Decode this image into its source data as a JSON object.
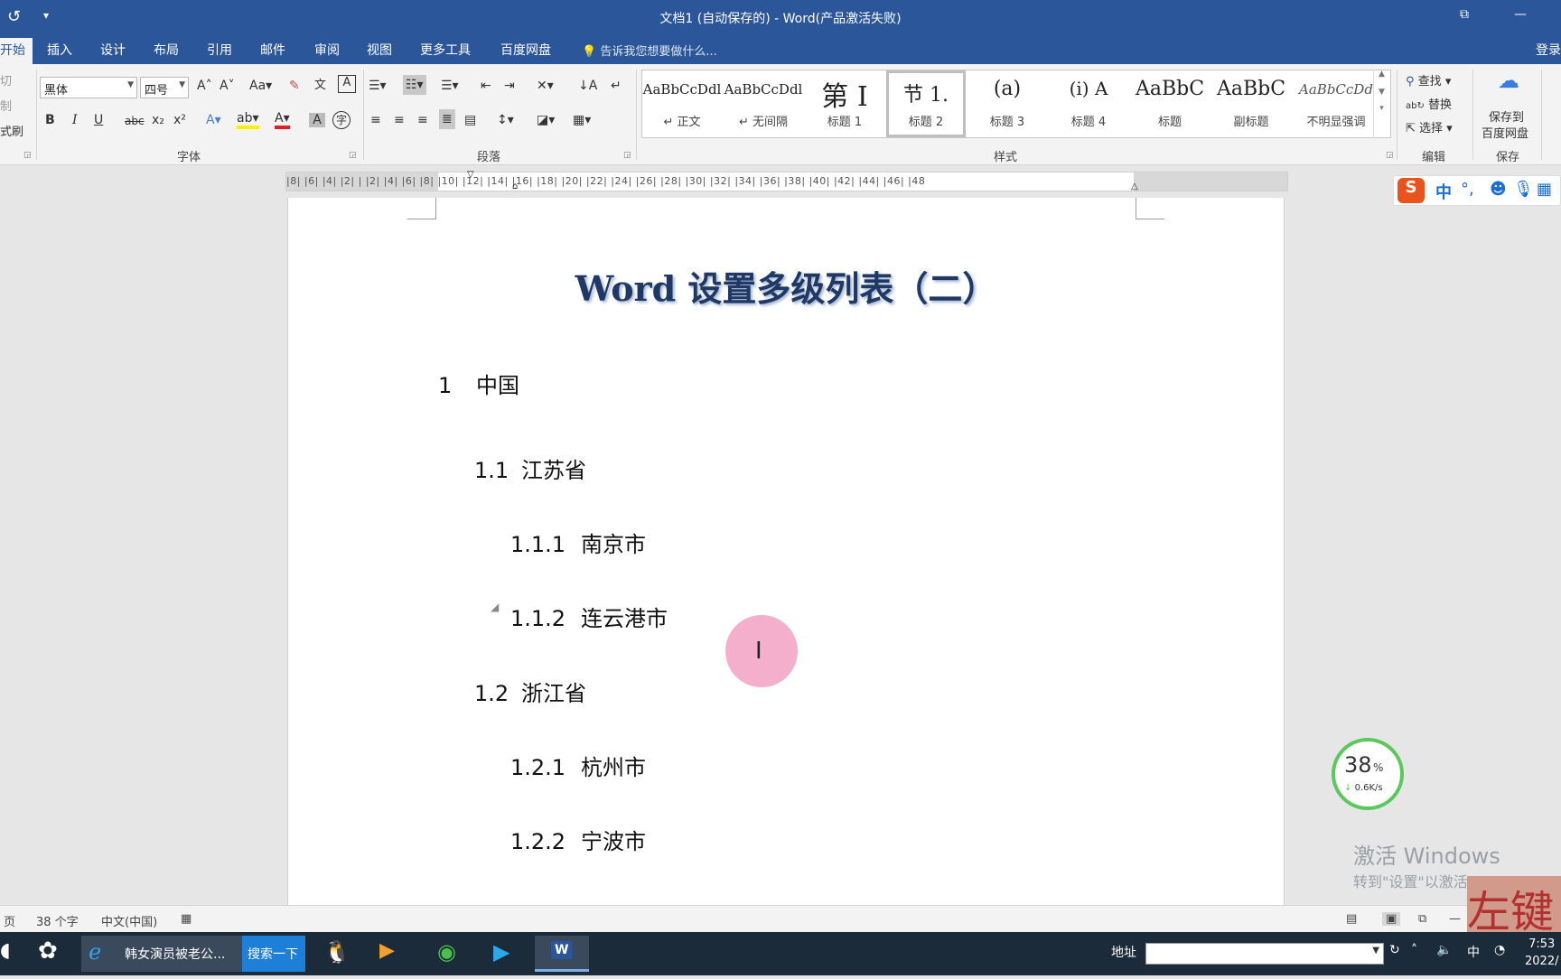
{
  "window": {
    "title": "文档1 (自动保存的) - Word(产品激活失败)",
    "quick_access_icon": "refresh-icon",
    "restore_icon": "restore-icon",
    "minimize": "—"
  },
  "tabs": {
    "items": [
      "开始",
      "插入",
      "设计",
      "布局",
      "引用",
      "邮件",
      "审阅",
      "视图",
      "更多工具",
      "百度网盘"
    ],
    "tell_me": "告诉我您想要做什么...",
    "login": "登录"
  },
  "clipboard": {
    "cut": "切",
    "copy": "制",
    "format_painter": "式刷"
  },
  "font": {
    "family": "黑体",
    "size": "四号",
    "group_label": "字体",
    "bold": "B",
    "italic": "I",
    "underline": "U",
    "strike": "abc",
    "sub": "x₂",
    "sup": "x²",
    "case": "Aa"
  },
  "paragraph": {
    "group_label": "段落"
  },
  "styles": {
    "group_label": "样式",
    "items": [
      {
        "sample": "AaBbCcDdl",
        "name": "↵ 正文"
      },
      {
        "sample": "AaBbCcDdl",
        "name": "↵ 无间隔"
      },
      {
        "sample": "第 I",
        "name": "标题 1"
      },
      {
        "sample": "节 1.",
        "name": "标题 2"
      },
      {
        "sample": "(a)",
        "name": "标题 3"
      },
      {
        "sample": "(i) A",
        "name": "标题 4"
      },
      {
        "sample": "AaBbC",
        "name": "标题"
      },
      {
        "sample": "AaBbC",
        "name": "副标题"
      },
      {
        "sample": "AaBbCcDd",
        "name": "不明显强调"
      }
    ],
    "selected_index": 3
  },
  "editing": {
    "group_label": "编辑",
    "find": "查找",
    "replace": "替换",
    "select": "选择"
  },
  "save": {
    "group_label": "保存",
    "label_line1": "保存到",
    "label_line2": "百度网盘"
  },
  "ruler": {
    "ticks": "|8|  |6|  |4|  |2|  |  |2|  |4|  |6|  |8|  |10|  |12|  |14|  |16|  |18|  |20|  |22|  |24|  |26|  |28|  |30|  |32|  |34|  |36|  |38|  |40|  |42|  |44|  |46|  |48"
  },
  "document": {
    "title": "Word 设置多级列表（二）",
    "items": [
      {
        "num": "1",
        "text": "中国"
      },
      {
        "num": "1.1",
        "text": "江苏省"
      },
      {
        "num": "1.1.1",
        "text": "南京市"
      },
      {
        "num": "1.1.2",
        "text": "连云港市"
      },
      {
        "num": "1.2",
        "text": "浙江省"
      },
      {
        "num": "1.2.1",
        "text": "杭州市"
      },
      {
        "num": "1.2.2",
        "text": "宁波市"
      }
    ]
  },
  "status": {
    "page": "页",
    "words": "38 个字",
    "language": "中文(中国)"
  },
  "ime": {
    "lang": "中",
    "punct": "°,"
  },
  "network": {
    "percent": "38",
    "percent_unit": "%",
    "speed": "0.6K/s"
  },
  "activation": {
    "line1": "激活 Windows",
    "line2": "转到\"设置\"以激活 Windows"
  },
  "decor": {
    "corner_text": "左键"
  },
  "taskbar": {
    "ie_tab": "韩女演员被老公...",
    "search_button": "搜索一下",
    "address_label": "地址",
    "tray_lang": "中",
    "clock_time": "7:53",
    "clock_date": "2022/"
  }
}
